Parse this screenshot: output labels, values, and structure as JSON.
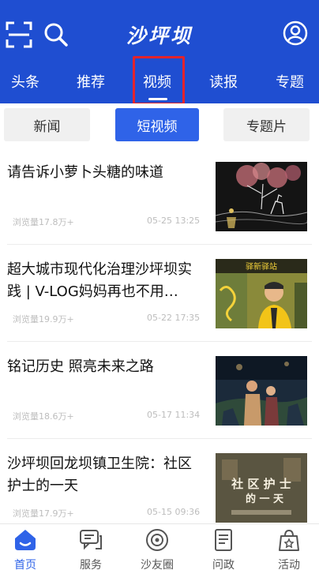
{
  "header": {
    "logo_text": "沙坪坝",
    "bg_color": "#1f4ed1",
    "scan_icon": "scan-icon",
    "search_icon": "search-icon",
    "user_icon": "user-icon"
  },
  "nav_tabs": [
    {
      "label": "头条"
    },
    {
      "label": "推荐"
    },
    {
      "label": "视频",
      "active": true
    },
    {
      "label": "读报"
    },
    {
      "label": "专题"
    }
  ],
  "subtabs": [
    {
      "label": "新闻"
    },
    {
      "label": "短视频",
      "active": true
    },
    {
      "label": "专题片"
    }
  ],
  "feed": [
    {
      "title": "请告诉小萝卜头糖的味道",
      "views": "浏览量17.8万+",
      "time": "05-25 13:25"
    },
    {
      "title": "超大城市现代化治理沙坪坝实践 | V-LOG妈妈再也不用…",
      "views": "浏览量19.9万+",
      "time": "05-22 17:35"
    },
    {
      "title": "铭记历史 照亮未来之路",
      "views": "浏览量18.6万+",
      "time": "05-17 11:34"
    },
    {
      "title": "沙坪坝回龙坝镇卫生院：社区护士的一天",
      "views": "浏览量17.9万+",
      "time": "05-15 09:36"
    }
  ],
  "thumbnails": {
    "t2_sign": "驿新驿站",
    "t4_text": "社 区 护 士",
    "t4_sub": "的 一 天"
  },
  "bottom_nav": [
    {
      "label": "首页",
      "icon": "home-icon",
      "active": true
    },
    {
      "label": "服务",
      "icon": "service-chat-icon"
    },
    {
      "label": "沙友圈",
      "icon": "disc-icon"
    },
    {
      "label": "问政",
      "icon": "document-icon"
    },
    {
      "label": "活动",
      "icon": "gift-bag-icon"
    }
  ],
  "colors": {
    "accent": "#2f63e8",
    "highlight_box": "#e3232c"
  }
}
